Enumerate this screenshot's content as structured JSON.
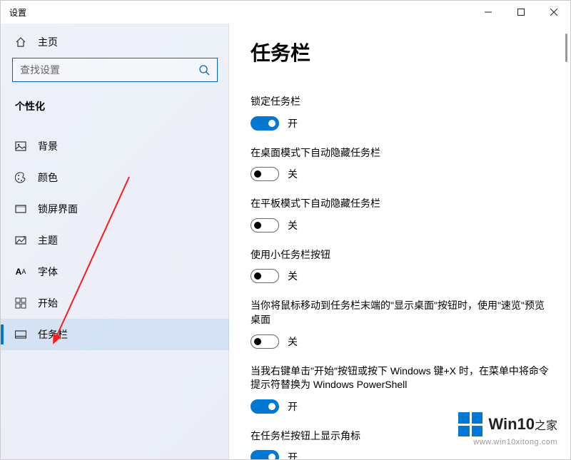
{
  "window": {
    "title": "设置"
  },
  "sidebar": {
    "home": "主页",
    "search_placeholder": "查找设置",
    "section": "个性化",
    "items": [
      {
        "label": "背景",
        "icon": "image"
      },
      {
        "label": "颜色",
        "icon": "palette"
      },
      {
        "label": "锁屏界面",
        "icon": "lock-screen"
      },
      {
        "label": "主题",
        "icon": "theme"
      },
      {
        "label": "字体",
        "icon": "font"
      },
      {
        "label": "开始",
        "icon": "start"
      },
      {
        "label": "任务栏",
        "icon": "taskbar",
        "active": true
      }
    ]
  },
  "main": {
    "title": "任务栏",
    "settings": [
      {
        "label": "锁定任务栏",
        "on": true
      },
      {
        "label": "在桌面模式下自动隐藏任务栏",
        "on": false
      },
      {
        "label": "在平板模式下自动隐藏任务栏",
        "on": false
      },
      {
        "label": "使用小任务栏按钮",
        "on": false
      },
      {
        "label": "当你将鼠标移动到任务栏末端的\"显示桌面\"按钮时，使用\"速览\"预览桌面",
        "on": false
      },
      {
        "label": "当我右键单击\"开始\"按钮或按下 Windows 键+X 时，在菜单中将命令提示符替换为 Windows PowerShell",
        "on": true
      },
      {
        "label": "在任务栏按钮上显示角标",
        "on": true
      }
    ],
    "state_on": "开",
    "state_off": "关"
  },
  "watermark": {
    "brand_main": "Win10",
    "brand_sub": "之家",
    "url": "www.win10xitong.com"
  }
}
